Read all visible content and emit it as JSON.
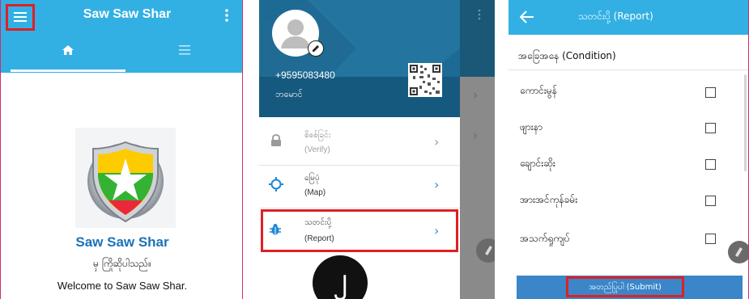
{
  "panel1": {
    "title": "Saw Saw Shar",
    "app_name": "Saw Saw Shar",
    "tagline": "မှ ကြိုဆိုပါသည်။",
    "welcome": "Welcome to Saw Saw Shar.",
    "colors": {
      "appbar": "#33b0e3",
      "brand_text": "#1a73b8",
      "highlight": "#e01f26"
    }
  },
  "panel2": {
    "phone": "+9595083480",
    "user_name": "ဘမောင်",
    "menu": [
      {
        "title": "စိစစ်ခြင်း",
        "sub": "(Verify)",
        "icon": "lock-icon"
      },
      {
        "title": "မြေပုံ",
        "sub": "(Map)",
        "icon": "map-target-icon"
      },
      {
        "title": "သတင်းပို့",
        "sub": "(Report)",
        "icon": "bug-icon"
      }
    ],
    "step_badge": "၂"
  },
  "panel3": {
    "title": "သတင်းပို့ (Report)",
    "section_heading": "အခြေအနေ (Condition)",
    "conditions": [
      {
        "label": "ကောင်းမွန်",
        "checked": false
      },
      {
        "label": "ဖျားနာ",
        "checked": false
      },
      {
        "label": "ချောင်းဆိုး",
        "checked": false
      },
      {
        "label": "အားအင်ကုန်ခမ်း",
        "checked": false
      },
      {
        "label": "အသက်ရှုကျပ်",
        "checked": false
      }
    ],
    "submit_label": "အတည်ပြုပါ (Submit)"
  }
}
